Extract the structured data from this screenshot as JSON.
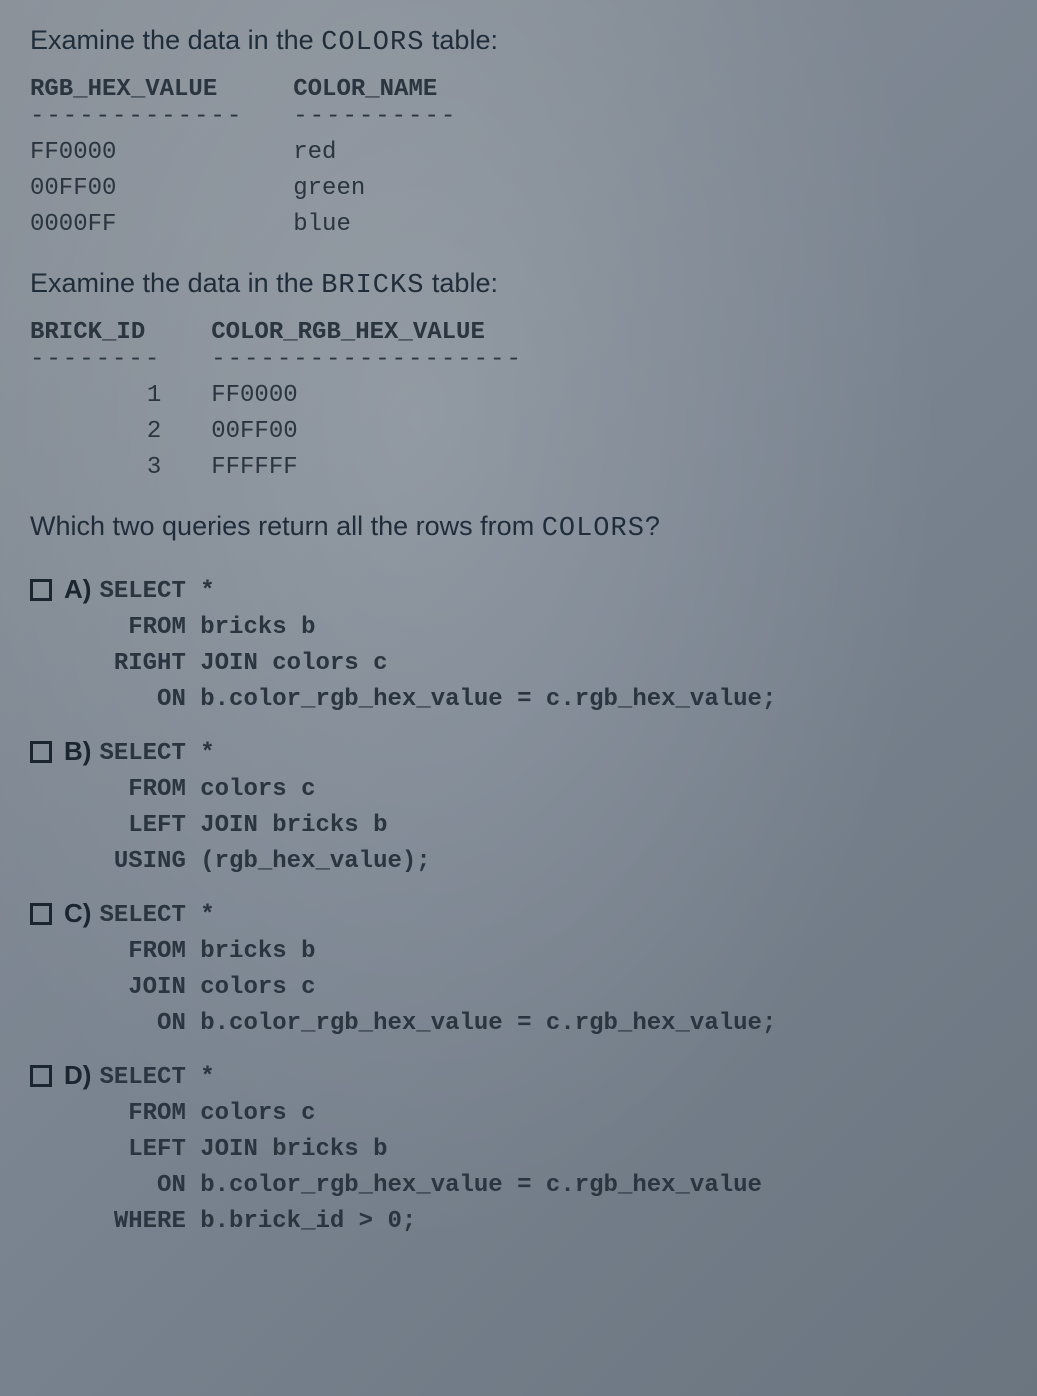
{
  "intro1_prefix": "Examine the data in the ",
  "intro1_table": "COLORS",
  "intro1_suffix": " table:",
  "colors_table": {
    "headers": [
      "RGB_HEX_VALUE",
      "COLOR_NAME"
    ],
    "dashes": [
      "-------------",
      "----------"
    ],
    "col1": [
      "FF0000",
      "00FF00",
      "0000FF"
    ],
    "col2": [
      "red",
      "green",
      "blue"
    ]
  },
  "intro2_prefix": "Examine the data in the ",
  "intro2_table": "BRICKS",
  "intro2_suffix": " table:",
  "bricks_table": {
    "headers": [
      "BRICK_ID",
      "COLOR_RGB_HEX_VALUE"
    ],
    "dashes": [
      "--------",
      "-------------------"
    ],
    "col1": [
      "1",
      "2",
      "3"
    ],
    "col2": [
      "FF0000",
      "00FF00",
      "FFFFFF"
    ]
  },
  "question_prefix": "Which two queries return all the rows from ",
  "question_table": "COLORS",
  "question_suffix": "?",
  "options": {
    "a": {
      "label": "A)",
      "code": "SELECT *\n  FROM bricks b\n RIGHT JOIN colors c\n    ON b.color_rgb_hex_value = c.rgb_hex_value;"
    },
    "b": {
      "label": "B)",
      "code": "SELECT *\n  FROM colors c\n  LEFT JOIN bricks b\n USING (rgb_hex_value);"
    },
    "c": {
      "label": "C)",
      "code": "SELECT *\n  FROM bricks b\n  JOIN colors c\n    ON b.color_rgb_hex_value = c.rgb_hex_value;"
    },
    "d": {
      "label": "D)",
      "code": "SELECT *\n  FROM colors c\n  LEFT JOIN bricks b\n    ON b.color_rgb_hex_value = c.rgb_hex_value\n WHERE b.brick_id > 0;"
    }
  }
}
